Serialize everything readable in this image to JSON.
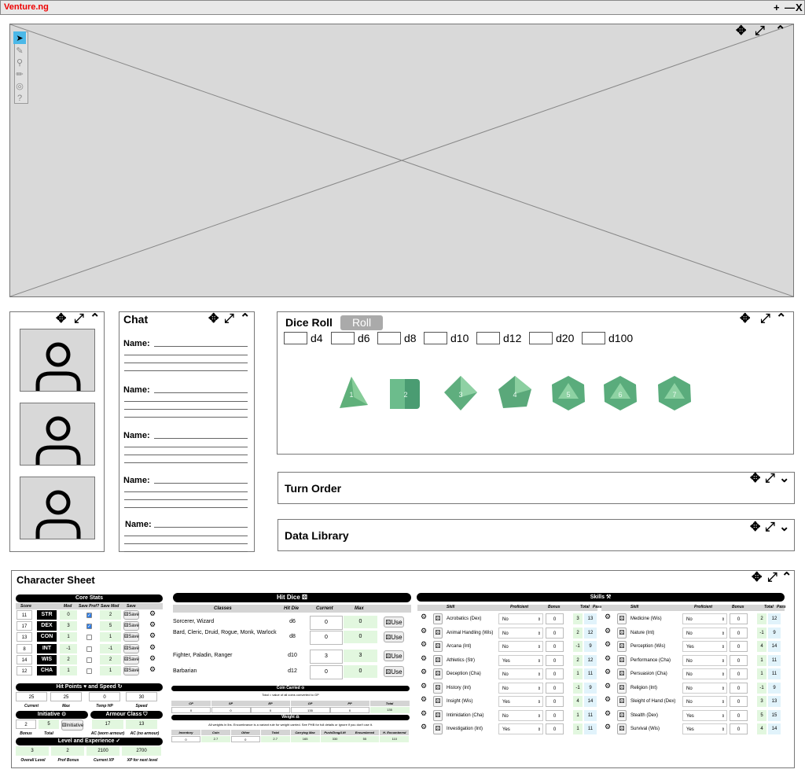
{
  "app": {
    "title": "Venture.ng",
    "controls": [
      "+",
      "—",
      "X"
    ]
  },
  "map_tools": [
    "arrow-icon",
    "pen-icon",
    "search-icon",
    "pencil-icon",
    "target-icon",
    "help-icon"
  ],
  "chat": {
    "title": "Chat",
    "name_label": "Name:"
  },
  "dice": {
    "title": "Dice Roll",
    "roll_label": "Roll",
    "dice": [
      "d4",
      "d6",
      "d8",
      "d10",
      "d12",
      "d20",
      "d100"
    ]
  },
  "turn_order": {
    "title": "Turn Order"
  },
  "data_library": {
    "title": "Data Library"
  },
  "sheet": {
    "title": "Character Sheet",
    "core": {
      "title": "Core Stats",
      "headers": [
        "Score",
        "",
        "Mod",
        "Save Prof?",
        "Save Mod",
        "Save"
      ],
      "save_label": "Save",
      "stats": [
        {
          "score": "11",
          "name": "STR",
          "mod": "0",
          "prof": true,
          "save": "2"
        },
        {
          "score": "17",
          "name": "DEX",
          "mod": "3",
          "prof": true,
          "save": "5"
        },
        {
          "score": "13",
          "name": "CON",
          "mod": "1",
          "prof": false,
          "save": "1"
        },
        {
          "score": "8",
          "name": "INT",
          "mod": "-1",
          "prof": false,
          "save": "-1"
        },
        {
          "score": "14",
          "name": "WIS",
          "mod": "2",
          "prof": false,
          "save": "2"
        },
        {
          "score": "12",
          "name": "CHA",
          "mod": "1",
          "prof": false,
          "save": "1"
        }
      ]
    },
    "hp": {
      "title": "Hit Points ♥ and Speed ↻",
      "values": [
        "25",
        "25",
        "0",
        "30"
      ],
      "labels": [
        "Current",
        "Max",
        "Temp HP",
        "Speed"
      ]
    },
    "initiative": {
      "title": "Initiative ⊙",
      "bonus": "2",
      "total": "5",
      "button": "Initiative",
      "labels": [
        "Bonus",
        "Total"
      ]
    },
    "armour": {
      "title": "Armour Class ⛉",
      "worn": "17",
      "no_armour": "13",
      "labels": [
        "AC (worn armour)",
        "AC (no armour)"
      ]
    },
    "level": {
      "title": "Level and Experience ✓",
      "values": [
        "3",
        "2",
        "2100",
        "2700"
      ],
      "labels": [
        "Overall Level",
        "Prof Bonus",
        "Current XP",
        "XP for next level"
      ]
    },
    "hit_dice": {
      "title": "Hit Dice ⚄",
      "headers": [
        "Classes",
        "Hit Die",
        "Current",
        "Max"
      ],
      "use_label": "Use",
      "rows": [
        {
          "classes": "Sorcerer, Wizard",
          "die": "d6",
          "current": "0",
          "max": "0"
        },
        {
          "classes": "Bard, Cleric, Druid, Rogue, Monk, Warlock",
          "die": "d8",
          "current": "0",
          "max": "0"
        },
        {
          "classes": "Fighter, Paladin, Ranger",
          "die": "d10",
          "current": "3",
          "max": "3"
        },
        {
          "classes": "Barbarian",
          "die": "d12",
          "current": "0",
          "max": "0"
        }
      ]
    },
    "coin": {
      "title": "Coin Carried ⊙",
      "note": "Total = value of all coins converted to GP",
      "headers": [
        "CP",
        "SP",
        "EP",
        "GP",
        "PP",
        "Total"
      ],
      "values": [
        "0",
        "0",
        "0",
        "135",
        "0",
        "135"
      ]
    },
    "weight": {
      "title": "Weight ⚖",
      "note": "All weights in lbs. Encumbrance is a variant rule for weight carried. See PHB for full details or ignore if you don't use it.",
      "headers": [
        "Inventory",
        "Coin",
        "Other",
        "Total",
        "Carrying Max",
        "Push/Drag/Lift",
        "Encumbered",
        "H. Encumbered"
      ],
      "values": [
        "0",
        "2.7",
        "0",
        "2.7",
        "165",
        "330",
        "55",
        "110"
      ]
    },
    "skills": {
      "title": "Skills ⚒",
      "headers": [
        "Skill",
        "Proficient",
        "Bonus",
        "Total",
        "Pass"
      ],
      "left": [
        {
          "name": "Acrobatics (Dex)",
          "prof": "No",
          "bonus": "0",
          "total": "3",
          "pass": "13"
        },
        {
          "name": "Animal Handling (Wis)",
          "prof": "No",
          "bonus": "0",
          "total": "2",
          "pass": "12"
        },
        {
          "name": "Arcana (Int)",
          "prof": "No",
          "bonus": "0",
          "total": "-1",
          "pass": "9"
        },
        {
          "name": "Athletics (Str)",
          "prof": "Yes",
          "bonus": "0",
          "total": "2",
          "pass": "12"
        },
        {
          "name": "Deception (Cha)",
          "prof": "No",
          "bonus": "0",
          "total": "1",
          "pass": "11"
        },
        {
          "name": "History (Int)",
          "prof": "No",
          "bonus": "0",
          "total": "-1",
          "pass": "9"
        },
        {
          "name": "Insight (Wis)",
          "prof": "Yes",
          "bonus": "0",
          "total": "4",
          "pass": "14"
        },
        {
          "name": "Intimidation (Cha)",
          "prof": "No",
          "bonus": "0",
          "total": "1",
          "pass": "11"
        },
        {
          "name": "Investigation (Int)",
          "prof": "Yes",
          "bonus": "0",
          "total": "1",
          "pass": "11"
        }
      ],
      "right": [
        {
          "name": "Medicine (Wis)",
          "prof": "No",
          "bonus": "0",
          "total": "2",
          "pass": "12"
        },
        {
          "name": "Nature (Int)",
          "prof": "No",
          "bonus": "0",
          "total": "-1",
          "pass": "9"
        },
        {
          "name": "Perception (Wis)",
          "prof": "Yes",
          "bonus": "0",
          "total": "4",
          "pass": "14"
        },
        {
          "name": "Performance (Cha)",
          "prof": "No",
          "bonus": "0",
          "total": "1",
          "pass": "11"
        },
        {
          "name": "Persuasion (Cha)",
          "prof": "No",
          "bonus": "0",
          "total": "1",
          "pass": "11"
        },
        {
          "name": "Religion (Int)",
          "prof": "No",
          "bonus": "0",
          "total": "-1",
          "pass": "9"
        },
        {
          "name": "Sleight of Hand (Dex)",
          "prof": "No",
          "bonus": "0",
          "total": "3",
          "pass": "13"
        },
        {
          "name": "Stealth (Dex)",
          "prof": "Yes",
          "bonus": "0",
          "total": "5",
          "pass": "15"
        },
        {
          "name": "Survival (Wis)",
          "prof": "Yes",
          "bonus": "0",
          "total": "4",
          "pass": "14"
        }
      ]
    }
  }
}
